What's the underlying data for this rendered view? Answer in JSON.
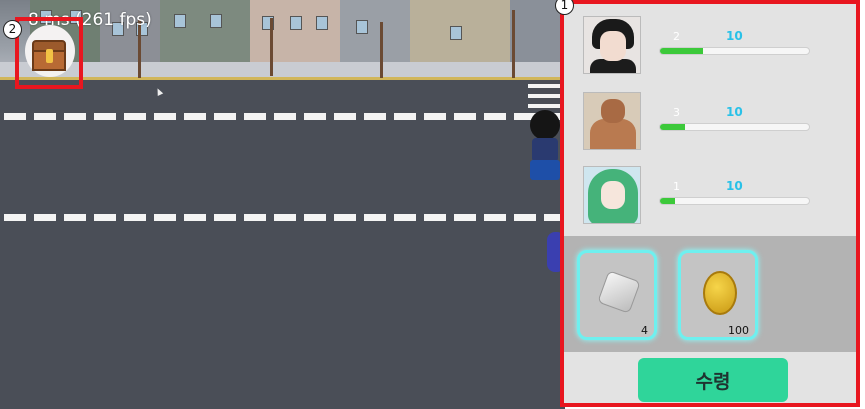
{
  "hud": {
    "fps_text": "8 ms (261 fps)",
    "markers": {
      "chest": "2",
      "panel": "1"
    }
  },
  "chest_button": {
    "icon": "treasure-chest-icon"
  },
  "heroes": [
    {
      "level": "2",
      "max_level": "10",
      "progress": 0.29,
      "portrait": "dark-haired-man-portrait"
    },
    {
      "level": "3",
      "max_level": "10",
      "progress": 0.17,
      "portrait": "muscular-brute-portrait"
    },
    {
      "level": "1",
      "max_level": "10",
      "progress": 0.1,
      "portrait": "green-haired-girl-portrait"
    }
  ],
  "inventory": [
    {
      "icon": "silver-gem-icon",
      "count": "4"
    },
    {
      "icon": "gold-coin-icon",
      "count": "100"
    }
  ],
  "receive_button": {
    "label": "수령"
  },
  "colors": {
    "accent": "#e8161f",
    "button": "#2fd59a",
    "level_blue": "#29c1e8",
    "bar_green": "#3cc93a",
    "slot_glow": "#6ef0ef"
  }
}
